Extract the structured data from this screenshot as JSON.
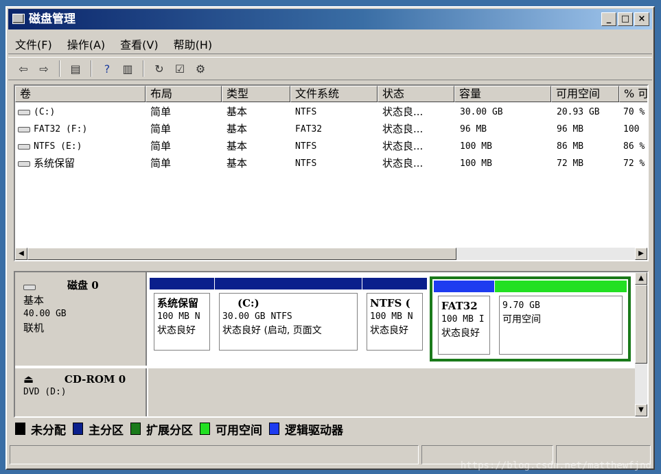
{
  "window": {
    "title": "磁盘管理",
    "minimize": "_",
    "maximize": "□",
    "close": "×"
  },
  "menu": [
    "文件(F)",
    "操作(A)",
    "查看(V)",
    "帮助(H)"
  ],
  "toolbar_icons": [
    "back-icon",
    "forward-icon",
    "view-icon",
    "help-icon",
    "view2-icon",
    "refresh-icon",
    "properties-icon",
    "settings-icon"
  ],
  "columns": [
    "卷",
    "布局",
    "类型",
    "文件系统",
    "状态",
    "容量",
    "可用空间",
    "% 可"
  ],
  "volumes": [
    {
      "name": "(C:)",
      "layout": "简单",
      "type": "基本",
      "fs": "NTFS",
      "status": "状态良...",
      "capacity": "30.00 GB",
      "free": "20.93 GB",
      "pct": "70 %"
    },
    {
      "name": "FAT32 (F:)",
      "layout": "简单",
      "type": "基本",
      "fs": "FAT32",
      "status": "状态良...",
      "capacity": "96 MB",
      "free": "96 MB",
      "pct": "100"
    },
    {
      "name": "NTFS (E:)",
      "layout": "简单",
      "type": "基本",
      "fs": "NTFS",
      "status": "状态良...",
      "capacity": "100 MB",
      "free": "86 MB",
      "pct": "86 %"
    },
    {
      "name": "系统保留",
      "layout": "简单",
      "type": "基本",
      "fs": "NTFS",
      "status": "状态良...",
      "capacity": "100 MB",
      "free": "72 MB",
      "pct": "72 %"
    }
  ],
  "disk0": {
    "name": "磁盘 0",
    "kind": "基本",
    "size": "40.00 GB",
    "state": "联机"
  },
  "partitions": [
    {
      "title": "系统保留",
      "line1": "100 MB N",
      "line2": "状态良好"
    },
    {
      "title": "(C:)",
      "line1": "30.00 GB NTFS",
      "line2": "状态良好 (启动, 页面文"
    },
    {
      "title": "NTFS (",
      "line1": "100 MB N",
      "line2": "状态良好"
    },
    {
      "title": "FAT32",
      "line1": "100 MB I",
      "line2": "状态良好"
    },
    {
      "title": "",
      "line1": "9.70 GB",
      "line2": "可用空间"
    }
  ],
  "cdrom": {
    "name": "CD-ROM 0",
    "label": "DVD (D:)"
  },
  "legend": [
    {
      "label": "未分配",
      "color": "#000000"
    },
    {
      "label": "主分区",
      "color": "#0a1f8c"
    },
    {
      "label": "扩展分区",
      "color": "#1a7a1a"
    },
    {
      "label": "可用空间",
      "color": "#22e022"
    },
    {
      "label": "逻辑驱动器",
      "color": "#1e3cf0"
    }
  ],
  "watermark": "https://blog.csdn.net/matthewfjnd"
}
